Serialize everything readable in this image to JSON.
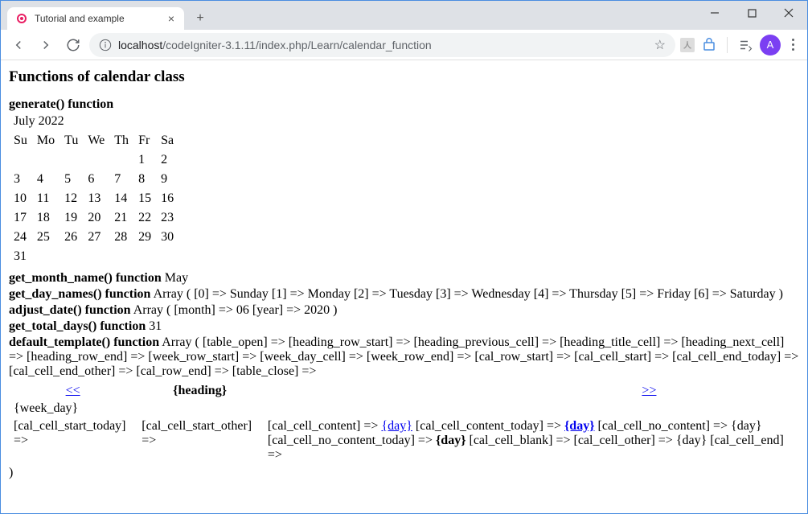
{
  "window": {
    "tab_title": "Tutorial and example"
  },
  "toolbar": {
    "url_host": "localhost",
    "url_path": "/codeIgniter-3.1.11/index.php/Learn/calendar_function",
    "avatar_letter": "A"
  },
  "page": {
    "heading": "Functions of calendar class",
    "generate_label": "generate() function",
    "calendar": {
      "heading": "July 2022",
      "daynames": [
        "Su",
        "Mo",
        "Tu",
        "We",
        "Th",
        "Fr",
        "Sa"
      ],
      "weeks": [
        [
          "",
          "",
          "",
          "",
          "",
          "1",
          "2"
        ],
        [
          "3",
          "4",
          "5",
          "6",
          "7",
          "8",
          "9"
        ],
        [
          "10",
          "11",
          "12",
          "13",
          "14",
          "15",
          "16"
        ],
        [
          "17",
          "18",
          "19",
          "20",
          "21",
          "22",
          "23"
        ],
        [
          "24",
          "25",
          "26",
          "27",
          "28",
          "29",
          "30"
        ],
        [
          "31",
          "",
          "",
          "",
          "",
          "",
          ""
        ]
      ]
    },
    "get_month_name_label": "get_month_name() function",
    "get_month_name_value": "May",
    "get_day_names_label": "get_day_names() function",
    "get_day_names_value": "Array ( [0] => Sunday [1] => Monday [2] => Tuesday [3] => Wednesday [4] => Thursday [5] => Friday [6] => Saturday )",
    "adjust_date_label": "adjust_date() function",
    "adjust_date_value": "Array ( [month] => 06 [year] => 2020 )",
    "get_total_days_label": "get_total_days() function",
    "get_total_days_value": "31",
    "default_template_label": "default_template() function",
    "default_template_value": "Array ( [table_open] => [heading_row_start] => [heading_previous_cell] => [heading_title_cell] => [heading_next_cell] => [heading_row_end] => [week_row_start] => [week_day_cell] => [week_row_end] => [cal_row_start] => [cal_cell_start] => [cal_cell_end_today] => [cal_cell_end_other] => [cal_row_end] => [table_close] =>",
    "tmpl": {
      "prev": "<<",
      "heading": "{heading}",
      "next": ">>",
      "week_day": "{week_day}",
      "cell_start_today": "[cal_cell_start_today] =>",
      "cell_start_other": "[cal_cell_start_other] =>",
      "cell_content_a": "[cal_cell_content] => ",
      "day_link1": "{day}",
      "cell_content_today": " [cal_cell_content_today] => ",
      "day_link2": "{day}",
      "cell_no_content": " [cal_cell_no_content] => {day} [cal_cell_no_content_today] => ",
      "day_bold": "{day}",
      "cell_blank_end": " [cal_cell_blank] =>   [cal_cell_other] => {day} [cal_cell_end] =>",
      "close_paren": ")"
    }
  }
}
